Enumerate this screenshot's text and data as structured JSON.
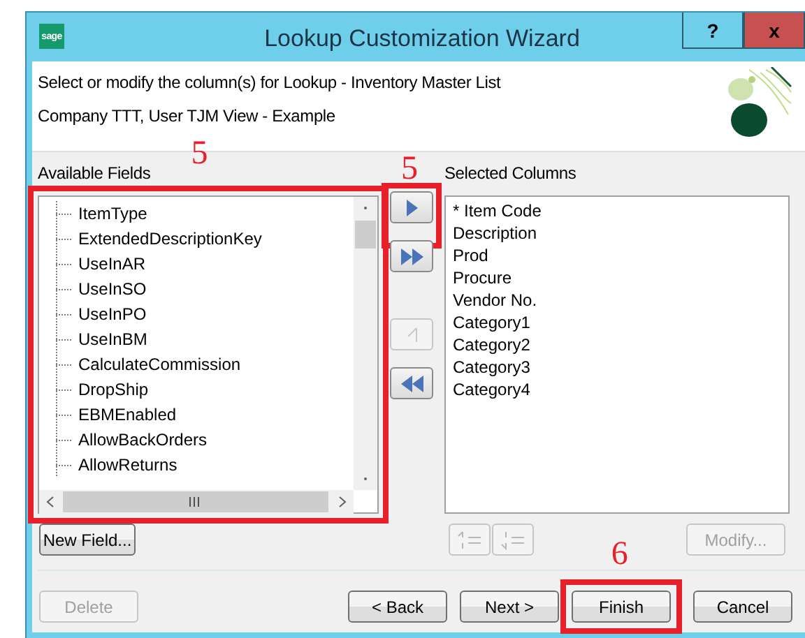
{
  "window": {
    "logo": "sage",
    "title": "Lookup Customization Wizard",
    "help": "?",
    "close": "x"
  },
  "header": {
    "lines": [
      "Select or modify the column(s) for Lookup - Inventory Master List",
      "Company TTT, User TJM View - Example"
    ]
  },
  "available_fields": {
    "label": "Available Fields",
    "annotation": "5",
    "items": [
      "ItemType",
      "ExtendedDescriptionKey",
      "UseInAR",
      "UseInSO",
      "UseInPO",
      "UseInBM",
      "CalculateCommission",
      "DropShip",
      "EBMEnabled",
      "AllowBackOrders",
      "AllowReturns"
    ]
  },
  "transfer_buttons": [
    {
      "kind": "add",
      "disabled": false,
      "annotation": "5"
    },
    {
      "kind": "add_all",
      "disabled": false
    },
    {
      "kind": "remove",
      "disabled": true
    },
    {
      "kind": "remove_all",
      "disabled": false
    }
  ],
  "selected_columns": {
    "label": "Selected Columns",
    "items": [
      "* Item Code",
      "Description",
      "Prod",
      "Procure",
      "Vendor No.",
      "Category1",
      "Category2",
      "Category3",
      "Category4"
    ]
  },
  "new_field_button": {
    "label": "New Field...",
    "disabled": false
  },
  "order_buttons": [
    {
      "kind": "move_up",
      "disabled": true
    },
    {
      "kind": "move_down",
      "disabled": true
    }
  ],
  "modify_button": {
    "label": "Modify...",
    "disabled": true
  },
  "footer_buttons": [
    {
      "label": "Delete",
      "disabled": true
    },
    {
      "label": "< Back",
      "disabled": false
    },
    {
      "label": "Next >",
      "disabled": false
    },
    {
      "label": "Finish",
      "disabled": false,
      "annotation": "6"
    },
    {
      "label": "Cancel",
      "disabled": false
    }
  ]
}
